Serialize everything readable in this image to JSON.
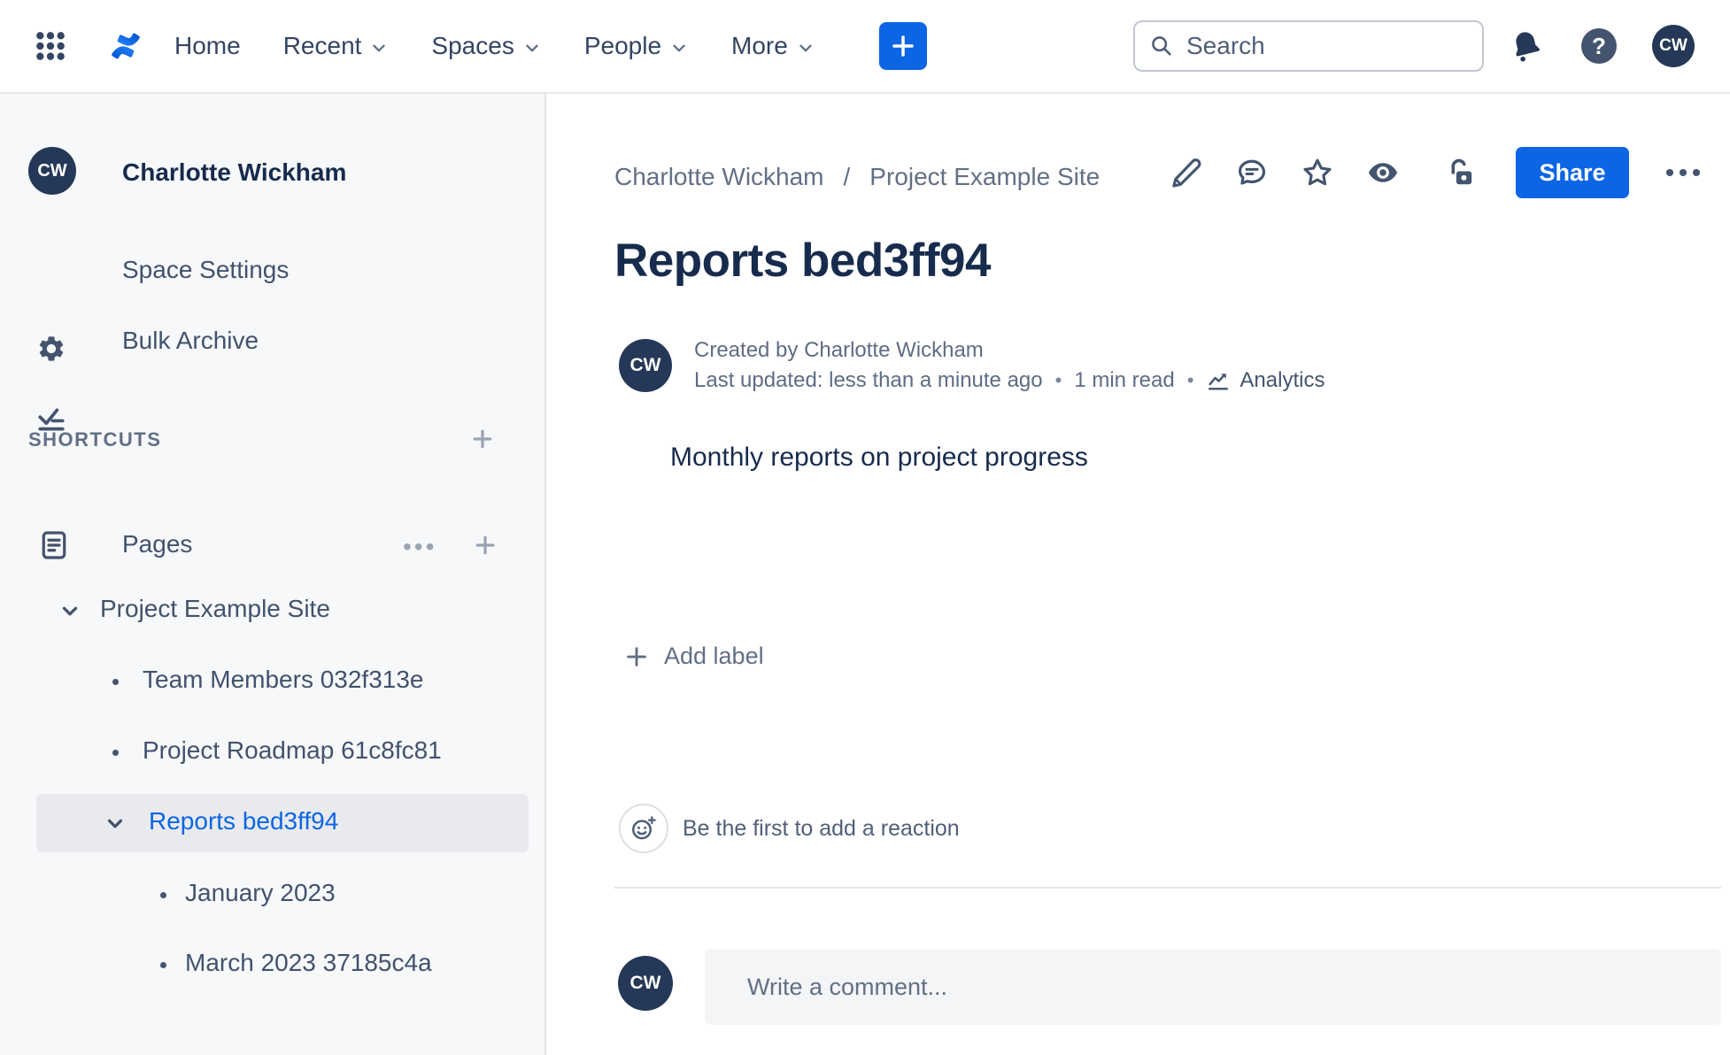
{
  "nav": {
    "items": [
      {
        "label": "Home",
        "has_dropdown": false
      },
      {
        "label": "Recent",
        "has_dropdown": true
      },
      {
        "label": "Spaces",
        "has_dropdown": true
      },
      {
        "label": "People",
        "has_dropdown": true
      },
      {
        "label": "More",
        "has_dropdown": true
      }
    ],
    "search": {
      "placeholder": "Search"
    },
    "help_glyph": "?",
    "profile_initials": "CW"
  },
  "sidebar": {
    "space": {
      "initials": "CW",
      "name": "Charlotte Wickham"
    },
    "menu": [
      {
        "label": "Space Settings"
      },
      {
        "label": "Bulk Archive"
      }
    ],
    "shortcuts_label": "SHORTCUTS",
    "pages_label": "Pages",
    "pages_more_glyph": "•••",
    "tree": [
      {
        "label": "Project Example Site",
        "level": 0,
        "marker": "chevron",
        "selected": false
      },
      {
        "label": "Team Members 032f313e",
        "level": 1,
        "marker": "bullet",
        "selected": false
      },
      {
        "label": "Project Roadmap 61c8fc81",
        "level": 1,
        "marker": "bullet",
        "selected": false
      },
      {
        "label": "Reports bed3ff94",
        "level": 1,
        "marker": "chevron",
        "selected": true
      },
      {
        "label": "January 2023",
        "level": 2,
        "marker": "bullet",
        "selected": false
      },
      {
        "label": "March 2023 37185c4a",
        "level": 2,
        "marker": "bullet",
        "selected": false
      }
    ]
  },
  "content": {
    "breadcrumb": {
      "items": [
        "Charlotte Wickham",
        "Project Example Site"
      ],
      "separator": "/"
    },
    "share_label": "Share",
    "title": "Reports bed3ff94",
    "byline": {
      "initials": "CW",
      "created": "Created by Charlotte Wickham",
      "updated": "Last updated: less than a minute ago",
      "dot": "•",
      "read_time": "1 min read",
      "analytics_label": "Analytics"
    },
    "body_text": "Monthly reports on project progress",
    "add_label": "Add label",
    "reaction_prompt": "Be the first to add a reaction",
    "comment_placeholder": "Write a comment..."
  },
  "colors": {
    "accent_blue": "#0C66E4",
    "navy_text": "#172B4D",
    "icon_navy": "#44546F",
    "avatar_bg": "#253858",
    "sidebar_bg": "#F7F8F9",
    "selected_row_bg": "#E9EAEE"
  }
}
